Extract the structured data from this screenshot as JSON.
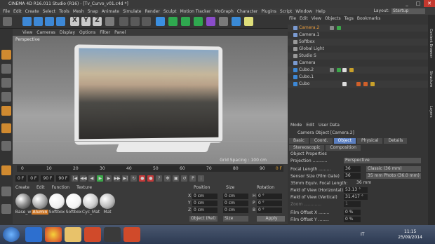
{
  "app": {
    "title": "CINEMA 4D R16.011 Studio (R16) - [Tv_Curvo_v01.c4d *]"
  },
  "menubar": [
    "File",
    "Edit",
    "Create",
    "Select",
    "Tools",
    "Mesh",
    "Snap",
    "Animate",
    "Simulate",
    "Render",
    "Sculpt",
    "Motion Tracker",
    "MoGraph",
    "Character",
    "Plugins",
    "Script",
    "Window",
    "Help"
  ],
  "layout": {
    "label": "Layout:",
    "value": "Startup"
  },
  "viewport": {
    "menu": [
      "View",
      "Cameras",
      "Display",
      "Options",
      "Filter",
      "Panel"
    ],
    "label": "Perspective",
    "grid_spacing": "Grid Spacing : 100 cm"
  },
  "timeline": {
    "ticks": [
      "0",
      "10",
      "20",
      "30",
      "40",
      "50",
      "60",
      "70",
      "80",
      "90"
    ],
    "start": "0 F",
    "cur": "0 F",
    "end": "90 F",
    "end2": "90 F",
    "range_end": "0 F"
  },
  "materials": {
    "menu": [
      "Create",
      "Edit",
      "Function",
      "Texture"
    ],
    "items": [
      "Base_w",
      "Alumin",
      "Softbox",
      "Softbox",
      "Cyc_Mat",
      "Mat"
    ]
  },
  "coords": {
    "headers": [
      "Position",
      "Size",
      "Rotation"
    ],
    "axes": [
      "X",
      "Y",
      "Z"
    ],
    "pos": [
      "0 cm",
      "0 cm",
      "0 cm"
    ],
    "size": [
      "0 cm",
      "0 cm",
      "0 cm"
    ],
    "rot_labels": [
      "H",
      "P",
      "B"
    ],
    "rot": [
      "0 °",
      "0 °",
      "0 °"
    ],
    "mode": "Object (Rel)",
    "size_mode": "Size",
    "apply": "Apply"
  },
  "objects": {
    "menu": [
      "File",
      "Edit",
      "View",
      "Objects",
      "Tags",
      "Bookmarks"
    ],
    "items": [
      "Camera.2",
      "Camera.1",
      "Softbox",
      "Global Light",
      "Studio S",
      "Camera",
      "Cubo.2",
      "Cubo.1",
      "Cubo"
    ]
  },
  "attributes": {
    "menu": [
      "Mode",
      "Edit",
      "User Data"
    ],
    "object_title": "Camera Object [Camera.2]",
    "tabs": [
      "Basic",
      "Coord.",
      "Object",
      "Physical",
      "Details",
      "Stereoscopic",
      "Composition"
    ],
    "section": "Object Properties",
    "rows": [
      {
        "label": "Projection ...........",
        "value": "",
        "select": "Perspective"
      },
      {
        "label": "Focal Length .........",
        "value": "36",
        "select": "Classic (36 mm)"
      },
      {
        "label": "Sensor Size (Film Gate)",
        "value": "36",
        "select": "35 mm Photo (36.0 mm)"
      },
      {
        "label": "35mm Equiv. Focal Length:",
        "value": "36 mm",
        "select": ""
      },
      {
        "label": "Field of View (Horizontal)",
        "value": "53.13 °",
        "select": ""
      },
      {
        "label": "Field of View (Vertical)",
        "value": "31.417 °",
        "select": ""
      },
      {
        "label": "Zoom .............",
        "value": "1",
        "select": ""
      },
      {
        "label": "Film Offset X ........",
        "value": "0 %",
        "select": ""
      },
      {
        "label": "Film Offset Y ........",
        "value": "0 %",
        "select": ""
      }
    ]
  },
  "sidetabs": [
    "Content Browser",
    "Structure",
    "Layers"
  ],
  "taskbar": {
    "lang": "IT",
    "time": "11:15",
    "date": "25/09/2014"
  }
}
